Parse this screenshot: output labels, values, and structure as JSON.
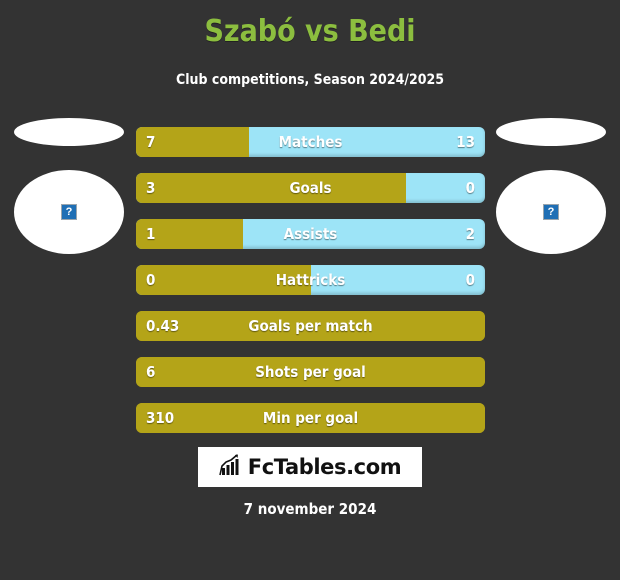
{
  "header": {
    "title": "Szabó vs Bedi",
    "subtitle": "Club competitions, Season 2024/2025",
    "title_color": "#8cbe3f"
  },
  "players": {
    "left": {
      "photo_alt": "broken-image",
      "placeholder_glyph": "?"
    },
    "right": {
      "photo_alt": "broken-image",
      "placeholder_glyph": "?"
    }
  },
  "theme": {
    "background": "#333333",
    "bar_left_color": "#b4a418",
    "bar_right_color": "#9de4f7",
    "text_color": "#ffffff"
  },
  "chart_data": {
    "type": "bar",
    "title": "Szabó vs Bedi",
    "subtitle": "Club competitions, Season 2024/2025",
    "orientation": "horizontal-diverging",
    "legend": [
      "Szabó",
      "Bedi"
    ],
    "categories": [
      "Matches",
      "Goals",
      "Assists",
      "Hattricks",
      "Goals per match",
      "Shots per goal",
      "Min per goal"
    ],
    "series": [
      {
        "name": "Szabó",
        "values": [
          7,
          3,
          1,
          0,
          0.43,
          6,
          310
        ]
      },
      {
        "name": "Bedi",
        "values": [
          13,
          0,
          2,
          0,
          null,
          null,
          null
        ]
      }
    ]
  },
  "stats": [
    {
      "label": "Matches",
      "left": "7",
      "right": "13",
      "fill_pct": 32.4,
      "has_right": true
    },
    {
      "label": "Goals",
      "left": "3",
      "right": "0",
      "fill_pct": 77.4,
      "has_right": true
    },
    {
      "label": "Assists",
      "left": "1",
      "right": "2",
      "fill_pct": 30.7,
      "has_right": true
    },
    {
      "label": "Hattricks",
      "left": "0",
      "right": "0",
      "fill_pct": 50.0,
      "has_right": true
    },
    {
      "label": "Goals per match",
      "left": "0.43",
      "right": "",
      "fill_pct": 100,
      "has_right": false
    },
    {
      "label": "Shots per goal",
      "left": "6",
      "right": "",
      "fill_pct": 100,
      "has_right": false
    },
    {
      "label": "Min per goal",
      "left": "310",
      "right": "",
      "fill_pct": 100,
      "has_right": false
    }
  ],
  "footer": {
    "logo_text": "FcTables.com",
    "logo_icon": "bar-chart-growth-icon",
    "date": "7 november 2024"
  }
}
